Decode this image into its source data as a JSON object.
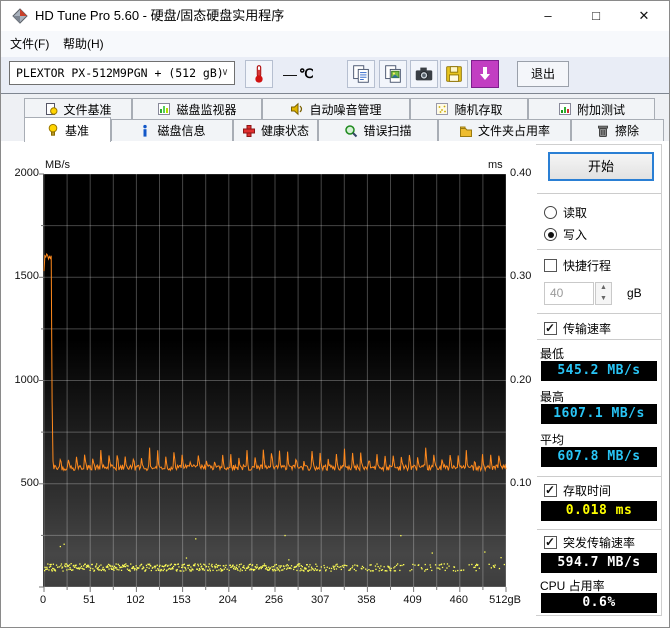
{
  "window": {
    "title": "HD Tune Pro 5.60 - 硬盘/固态硬盘实用程序",
    "controls": {
      "minimize": "–",
      "maximize": "□",
      "close": "✕"
    }
  },
  "menu": {
    "items": [
      {
        "label": "文件(F)"
      },
      {
        "label": "帮助(H)"
      }
    ]
  },
  "toolbar": {
    "drive_select": "PLEXTOR PX-512M9PGN + (512 gB)",
    "temperature_value": "—",
    "temperature_unit": "℃",
    "icons": [
      "thermometer-icon",
      "copy-text-icon",
      "copy-image-icon",
      "camera-icon",
      "save-icon",
      "download-icon"
    ],
    "exit_label": "退出"
  },
  "tabs": {
    "row_back": [
      {
        "label": "文件基准",
        "icon": "file-benchmark-icon"
      },
      {
        "label": "磁盘监视器",
        "icon": "disk-monitor-icon"
      },
      {
        "label": "自动噪音管理",
        "icon": "acoustic-icon"
      },
      {
        "label": "随机存取",
        "icon": "random-access-icon"
      },
      {
        "label": "附加测试",
        "icon": "extra-tests-icon"
      }
    ],
    "row_front": [
      {
        "label": "基准",
        "icon": "benchmark-icon",
        "active": true
      },
      {
        "label": "磁盘信息",
        "icon": "disk-info-icon",
        "active": false
      },
      {
        "label": "健康状态",
        "icon": "health-icon",
        "active": false
      },
      {
        "label": "错误扫描",
        "icon": "error-scan-icon",
        "active": false
      },
      {
        "label": "文件夹占用率",
        "icon": "folder-usage-icon",
        "active": false
      },
      {
        "label": "擦除",
        "icon": "erase-icon",
        "active": false
      }
    ]
  },
  "chart_data": {
    "type": "line",
    "x_axis": {
      "min": 0,
      "max": 512,
      "tick_labels": [
        "0",
        "51",
        "102",
        "153",
        "204",
        "256",
        "307",
        "358",
        "409",
        "460",
        "512gB"
      ],
      "minor_grid_step_gb": 25.6
    },
    "y_axis_left": {
      "unit": "MB/s",
      "min": 0,
      "max": 2000,
      "tick_labels": [
        "2000",
        "1500",
        "1000",
        "500"
      ],
      "minor_grid_step": 250
    },
    "y_axis_right": {
      "unit": "ms",
      "min": 0,
      "max": 0.4,
      "tick_labels": [
        "0.40",
        "0.30",
        "0.20",
        "0.10"
      ]
    },
    "grid": true,
    "series": [
      {
        "name": "transfer-rate-write",
        "type": "line",
        "color": "#ff8a1e",
        "profile": {
          "seed": 42,
          "sample_step_gb": 1,
          "start_value": 1530,
          "peak_value": 1600,
          "peak_noise": 18,
          "peak_until_gb": 8,
          "drop_mid_value": 900,
          "steady_base": 578,
          "steady_noise": 14,
          "spike_period_gb": 9,
          "spike_min": 35,
          "spike_max": 95
        }
      },
      {
        "name": "access-time",
        "type": "scatter",
        "color": "#ffff55",
        "profile": {
          "seed": 7,
          "step_gb": 0.6,
          "band_min_ms": 0.016,
          "band_spread_ms": 0.007,
          "outlier_chance": 0.02,
          "outlier_extra_ms": 0.035,
          "dense_until_gb": 300,
          "density_dense": 0.85,
          "density_mid": 0.5,
          "density_sparse": 0.28
        }
      }
    ],
    "stats": {
      "min_mbs": 545.2,
      "max_mbs": 1607.1,
      "avg_mbs": 607.8,
      "access_ms": 0.018,
      "burst_mbs": 594.7,
      "cpu_pct": 0.6
    }
  },
  "controls": {
    "start_label": "开始",
    "read_label": "读取",
    "read_selected": false,
    "write_label": "写入",
    "write_selected": true,
    "short_stroke": {
      "label": "快捷行程",
      "checked": false,
      "value": "40",
      "unit": "gB"
    },
    "transfer": {
      "label": "传输速率",
      "checked": true,
      "min_label": "最低",
      "min_value": "545.2 MB/s",
      "max_label": "最高",
      "max_value": "1607.1 MB/s",
      "avg_label": "平均",
      "avg_value": "607.8 MB/s"
    },
    "access": {
      "label": "存取时间",
      "checked": true,
      "value": "0.018 ms"
    },
    "burst": {
      "label": "突发传输速率",
      "checked": true,
      "value": "594.7 MB/s"
    },
    "cpu": {
      "label": "CPU 占用率",
      "value": "0.6%"
    }
  }
}
